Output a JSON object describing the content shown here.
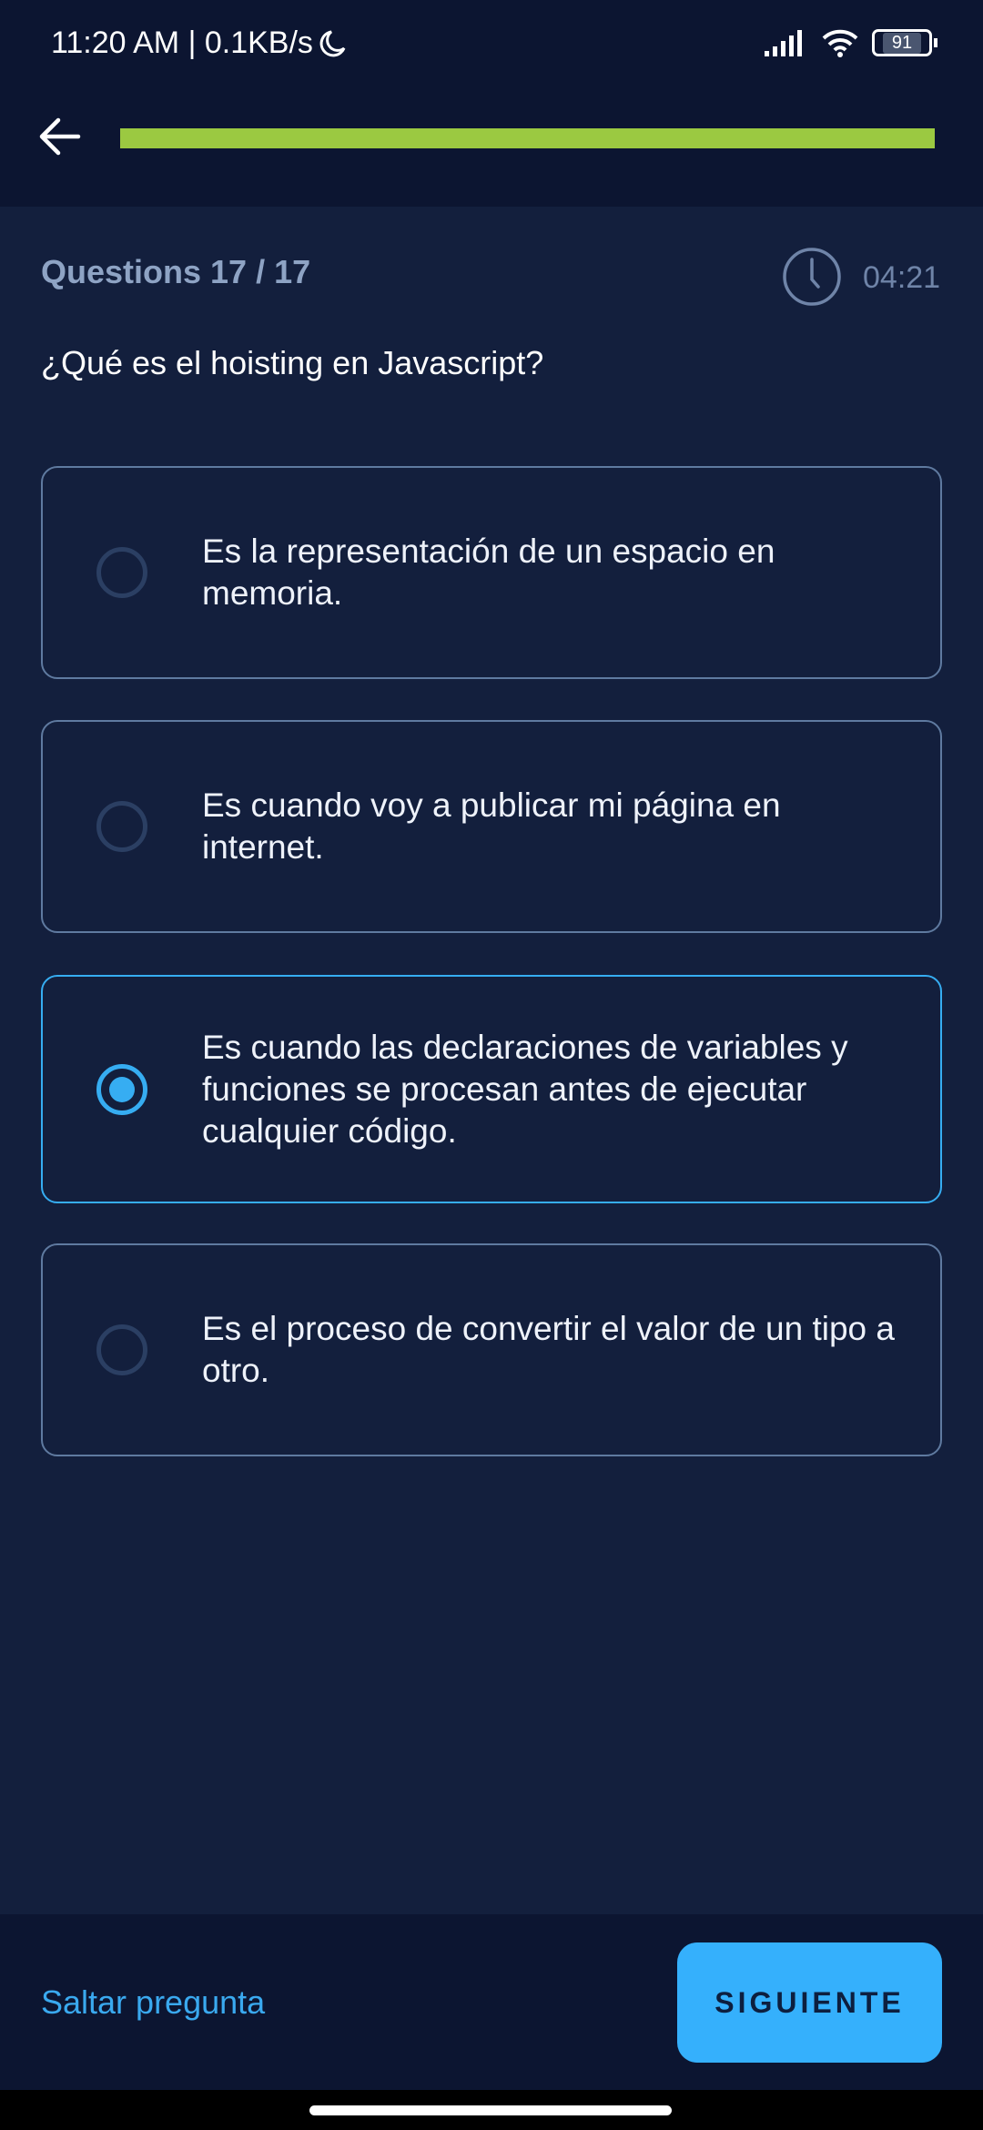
{
  "status_bar": {
    "time_speed": "11:20 AM | 0.1KB/s",
    "battery": "91"
  },
  "header": {
    "progress_percent": 100,
    "progress_color": "#9bc941"
  },
  "quiz": {
    "count_label": "Questions 17 / 17",
    "timer": "04:21",
    "question": "¿Qué es el hoisting en Javascript?",
    "options": [
      {
        "text": "Es la representación de un espacio en memoria.",
        "selected": false
      },
      {
        "text": "Es cuando voy a publicar mi página en internet.",
        "selected": false
      },
      {
        "text": "Es cuando las declaraciones de variables y funciones se procesan antes de ejecutar cualquier código.",
        "selected": true
      },
      {
        "text": "Es el proceso de convertir el valor de un tipo a otro.",
        "selected": false
      }
    ]
  },
  "footer": {
    "skip_label": "Saltar pregunta",
    "next_label": "SIGUIENTE"
  },
  "colors": {
    "accent": "#35b0fc",
    "background": "#131f3d",
    "header": "#0c1531"
  }
}
